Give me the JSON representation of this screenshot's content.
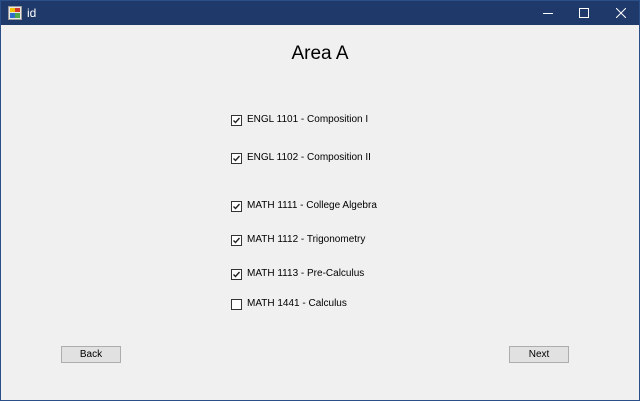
{
  "window": {
    "title": "id",
    "colors": {
      "titlebar": "#1f3a6a",
      "client": "#f0f0f0"
    }
  },
  "page": {
    "heading": "Area A"
  },
  "courses": [
    {
      "label": "ENGL 1101 - Composition I",
      "checked": true
    },
    {
      "label": "ENGL 1102 - Composition II",
      "checked": true
    },
    {
      "label": "MATH 1111 - College Algebra",
      "checked": true
    },
    {
      "label": "MATH 1112 - Trigonometry",
      "checked": true
    },
    {
      "label": "MATH 1113 - Pre-Calculus",
      "checked": true
    },
    {
      "label": "MATH 1441 - Calculus",
      "checked": false
    }
  ],
  "buttons": {
    "back": "Back",
    "next": "Next"
  }
}
